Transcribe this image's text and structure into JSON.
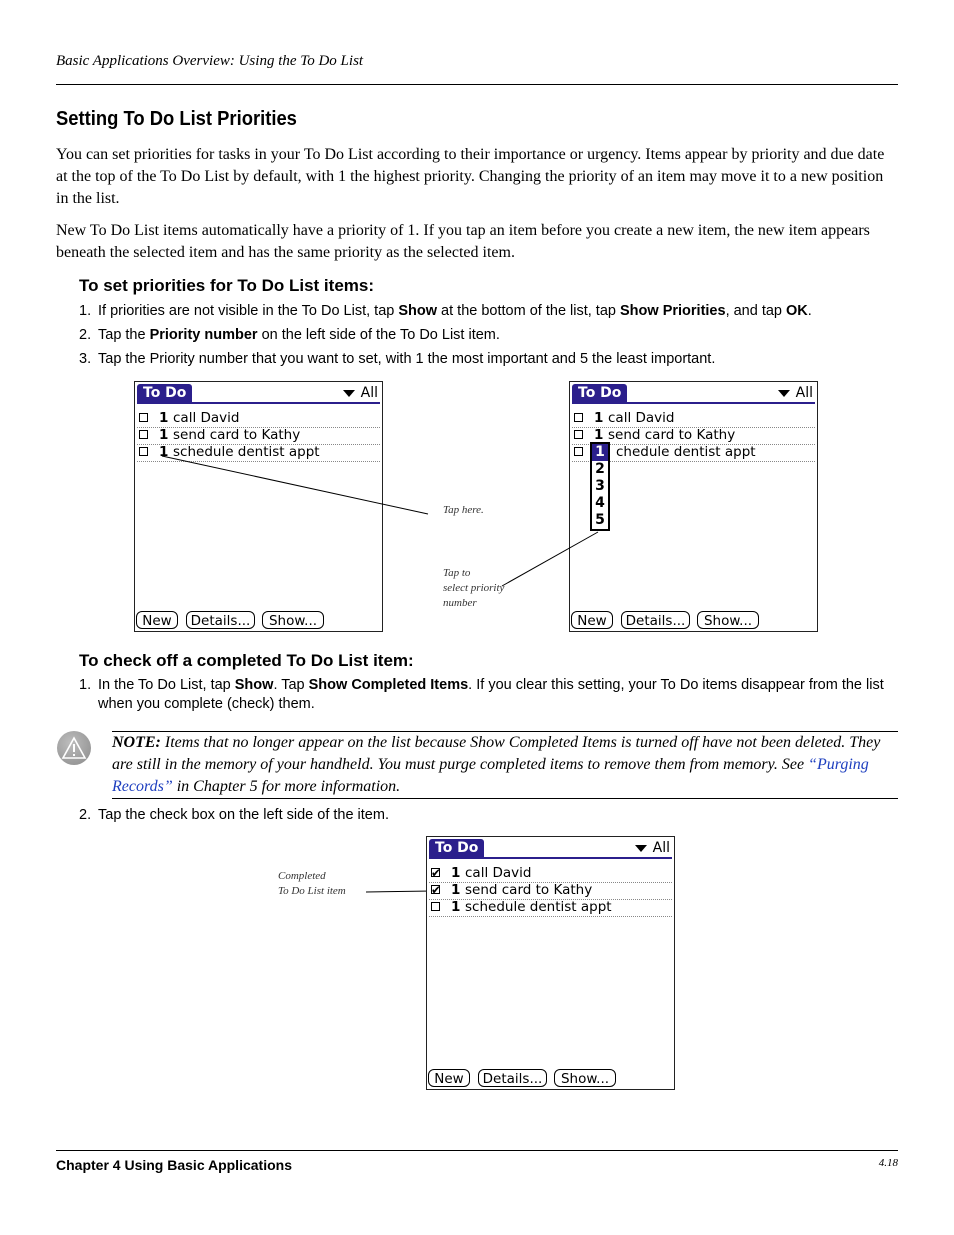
{
  "header": {
    "running_head": "Basic Applications Overview: Using the To Do List"
  },
  "section": {
    "title": "Setting To Do List Priorities",
    "para1": "You can set priorities for tasks in your To Do List according to their importance or urgency. Items appear by priority and due date at the top of the To Do List by default, with 1 the highest priority. Changing the priority of an item may move it to a new position in the list.",
    "para2": "New To Do List items automatically have a priority of 1. If you tap an item before you create a new item, the new item appears beneath the selected item and has the same priority as the selected item."
  },
  "proc1": {
    "heading": "To set priorities for To Do List items:",
    "steps": [
      {
        "num": "1.",
        "parts": [
          "If priorities are not visible in the To Do List, tap ",
          "Show",
          " at the bottom of the list, tap ",
          "Show Priorities",
          ", and tap ",
          "OK",
          "."
        ]
      },
      {
        "num": "2.",
        "parts": [
          "Tap the ",
          "Priority number",
          " on the left side of the To Do List item."
        ]
      },
      {
        "num": "3.",
        "text": "Tap the Priority number that you want to set, with 1 the most important and 5 the least important."
      }
    ]
  },
  "palm": {
    "tab_title": "To Do",
    "category": "All",
    "items": [
      {
        "priority": "1",
        "desc": "call David"
      },
      {
        "priority": "1",
        "desc": "send card to Kathy"
      },
      {
        "priority": "1",
        "desc": "schedule dentist appt"
      }
    ],
    "item3_partial": "chedule dentist appt",
    "priority_options": [
      "1",
      "2",
      "3",
      "4",
      "5"
    ],
    "buttons": {
      "new": "New",
      "details": "Details...",
      "show": "Show..."
    }
  },
  "callouts": {
    "tap_here": "Tap here.",
    "tap_to_select": [
      "Tap to",
      "select priority",
      "number"
    ],
    "completed": [
      "Completed",
      "To Do List item"
    ]
  },
  "proc2": {
    "heading": "To check off a completed To Do List item:",
    "step1": {
      "num": "1.",
      "parts": [
        "In the To Do List, tap ",
        "Show",
        ". Tap ",
        "Show Completed Items",
        ". If you clear this setting, your To Do items disappear from the list when you complete (check) them."
      ]
    },
    "step2": {
      "num": "2.",
      "text": "Tap the check box on the left side of the item."
    }
  },
  "note": {
    "label": "NOTE:",
    "text": " Items that no longer appear on the list because Show Completed Items is turned off have not been deleted. They are still in the memory of your handheld. You must purge completed items to remove them from memory. See ",
    "link": "“Purging Records”",
    "after": " in Chapter 5 for more information."
  },
  "footer": {
    "chapter": "Chapter 4 Using Basic Applications",
    "page": "4.18"
  }
}
